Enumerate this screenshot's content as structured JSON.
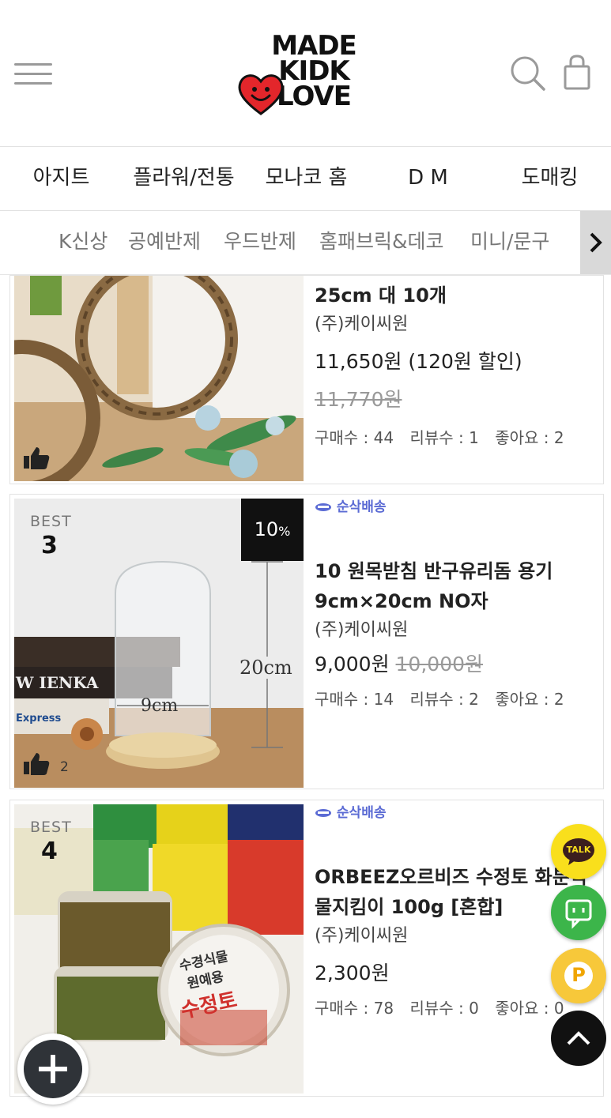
{
  "header": {
    "logo_lines": [
      "MADE",
      "KIDK",
      "LOVE"
    ]
  },
  "nav_primary": [
    "아지트",
    "플라워/전통",
    "모나코 홈",
    "D M",
    "도매킹"
  ],
  "nav_secondary": [
    "K신상",
    "공예반제",
    "우드반제",
    "홈패브릭&데코",
    "미니/문구"
  ],
  "products": [
    {
      "title_line2": "25cm 대 10개",
      "seller": "(주)케이씨원",
      "price": "11,650원 (120원 할인)",
      "original_price": "11,770원",
      "stats": {
        "purchases": "구매수 : 44",
        "reviews": "리뷰수 : 1",
        "likes": "좋아요 : 2"
      }
    },
    {
      "best_label": "BEST",
      "rank": "3",
      "discount_badge": "10",
      "discount_unit": "%",
      "thumb_likes": "2",
      "ship_badge": "순삭배송",
      "title_line1": "10 원목받침 반구유리돔 용기",
      "title_line2": "9cm×20cm NO자",
      "seller": "(주)케이씨원",
      "price": "9,000원",
      "original_price": "10,000원",
      "dim_height": "20cm",
      "dim_width": "9cm",
      "stats": {
        "purchases": "구매수 : 14",
        "reviews": "리뷰수 : 2",
        "likes": "좋아요 : 2"
      }
    },
    {
      "best_label": "BEST",
      "rank": "4",
      "ship_badge": "순삭배송",
      "title_line1": "ORBEEZ오르비즈 수정토 화분식",
      "title_line2": "물지킴이 100g [혼합]",
      "seller": "(주)케이씨원",
      "price": "2,300원",
      "stats": {
        "purchases": "구매수 : 78",
        "reviews": "리뷰수 : 0",
        "likes": "좋아요 : 0"
      },
      "jar_label_1": "수경식물",
      "jar_label_2": "원예용",
      "jar_label_3": "수정토"
    }
  ],
  "floating": {
    "talk_label": "TALK",
    "point_label": "P"
  },
  "colors": {
    "kakao_yellow": "#f9df1c",
    "chat_green": "#3cb54a",
    "point_yellow": "#f7c83a",
    "ship_blue": "#5b6bd4"
  }
}
